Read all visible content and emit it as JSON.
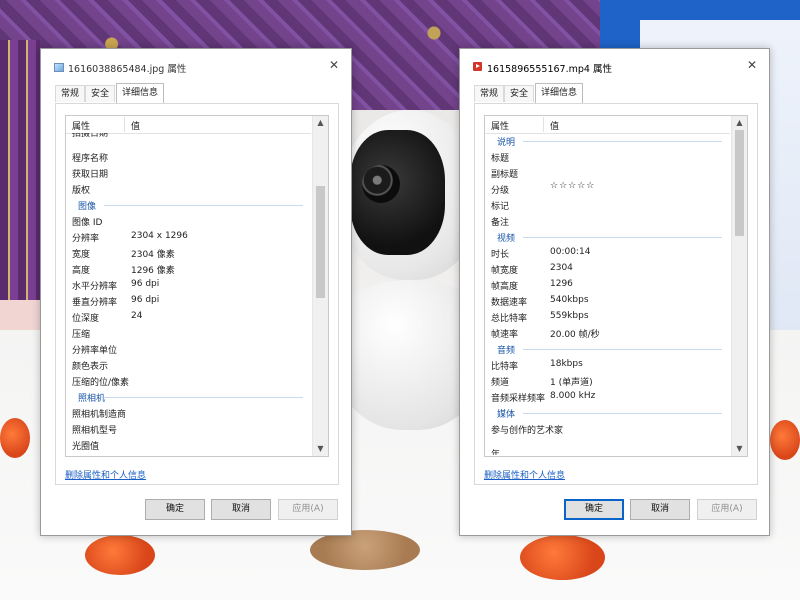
{
  "left_dialog": {
    "title": "1616038865484.jpg 属性",
    "tabs": [
      {
        "label": "常规",
        "active": false
      },
      {
        "label": "安全",
        "active": false
      },
      {
        "label": "详细信息",
        "active": true
      }
    ],
    "columns": {
      "property": "属性",
      "value": "值"
    },
    "rows": [
      {
        "k": "拍摄日期",
        "v": "",
        "cat": false,
        "cut": true
      },
      {
        "k": "程序名称",
        "v": "",
        "cat": false
      },
      {
        "k": "获取日期",
        "v": "",
        "cat": false
      },
      {
        "k": "版权",
        "v": "",
        "cat": false
      },
      {
        "k": "图像",
        "v": "",
        "cat": true
      },
      {
        "k": "图像 ID",
        "v": "",
        "cat": false
      },
      {
        "k": "分辨率",
        "v": "2304 x 1296",
        "cat": false
      },
      {
        "k": "宽度",
        "v": "2304 像素",
        "cat": false
      },
      {
        "k": "高度",
        "v": "1296 像素",
        "cat": false
      },
      {
        "k": "水平分辨率",
        "v": "96 dpi",
        "cat": false
      },
      {
        "k": "垂直分辨率",
        "v": "96 dpi",
        "cat": false
      },
      {
        "k": "位深度",
        "v": "24",
        "cat": false
      },
      {
        "k": "压缩",
        "v": "",
        "cat": false
      },
      {
        "k": "分辨率单位",
        "v": "",
        "cat": false
      },
      {
        "k": "颜色表示",
        "v": "",
        "cat": false
      },
      {
        "k": "压缩的位/像素",
        "v": "",
        "cat": false
      },
      {
        "k": "照相机",
        "v": "",
        "cat": true
      },
      {
        "k": "照相机制造商",
        "v": "",
        "cat": false
      },
      {
        "k": "照相机型号",
        "v": "",
        "cat": false
      },
      {
        "k": "光圈值",
        "v": "",
        "cat": false
      }
    ],
    "scroll_position": 0.28,
    "scroll_visible_fraction": 0.36,
    "remove_link": "删除属性和个人信息",
    "buttons": {
      "ok": "确定",
      "cancel": "取消",
      "apply": "应用(A)"
    }
  },
  "right_dialog": {
    "title": "1615896555167.mp4 属性",
    "tabs": [
      {
        "label": "常规",
        "active": false
      },
      {
        "label": "安全",
        "active": false
      },
      {
        "label": "详细信息",
        "active": true
      }
    ],
    "columns": {
      "property": "属性",
      "value": "值"
    },
    "rows": [
      {
        "k": "说明",
        "v": "",
        "cat": true
      },
      {
        "k": "标题",
        "v": "",
        "cat": false
      },
      {
        "k": "副标题",
        "v": "",
        "cat": false
      },
      {
        "k": "分级",
        "v": "☆☆☆☆☆",
        "cat": false,
        "stars": true
      },
      {
        "k": "标记",
        "v": "",
        "cat": false
      },
      {
        "k": "备注",
        "v": "",
        "cat": false
      },
      {
        "k": "视频",
        "v": "",
        "cat": true
      },
      {
        "k": "时长",
        "v": "00:00:14",
        "cat": false
      },
      {
        "k": "帧宽度",
        "v": "2304",
        "cat": false
      },
      {
        "k": "帧高度",
        "v": "1296",
        "cat": false
      },
      {
        "k": "数据速率",
        "v": "540kbps",
        "cat": false
      },
      {
        "k": "总比特率",
        "v": "559kbps",
        "cat": false
      },
      {
        "k": "帧速率",
        "v": "20.00 帧/秒",
        "cat": false
      },
      {
        "k": "音频",
        "v": "",
        "cat": true
      },
      {
        "k": "比特率",
        "v": "18kbps",
        "cat": false
      },
      {
        "k": "频道",
        "v": "1 (单声道)",
        "cat": false
      },
      {
        "k": "音频采样频率",
        "v": "8.000 kHz",
        "cat": false
      },
      {
        "k": "媒体",
        "v": "",
        "cat": true
      },
      {
        "k": "参与创作的艺术家",
        "v": "",
        "cat": false
      },
      {
        "k": "年",
        "v": "",
        "cat": false,
        "cut2": true
      }
    ],
    "scroll_position": 0.0,
    "scroll_visible_fraction": 0.34,
    "remove_link": "删除属性和个人信息",
    "buttons": {
      "ok": "确定",
      "cancel": "取消",
      "apply": "应用(A)"
    }
  }
}
